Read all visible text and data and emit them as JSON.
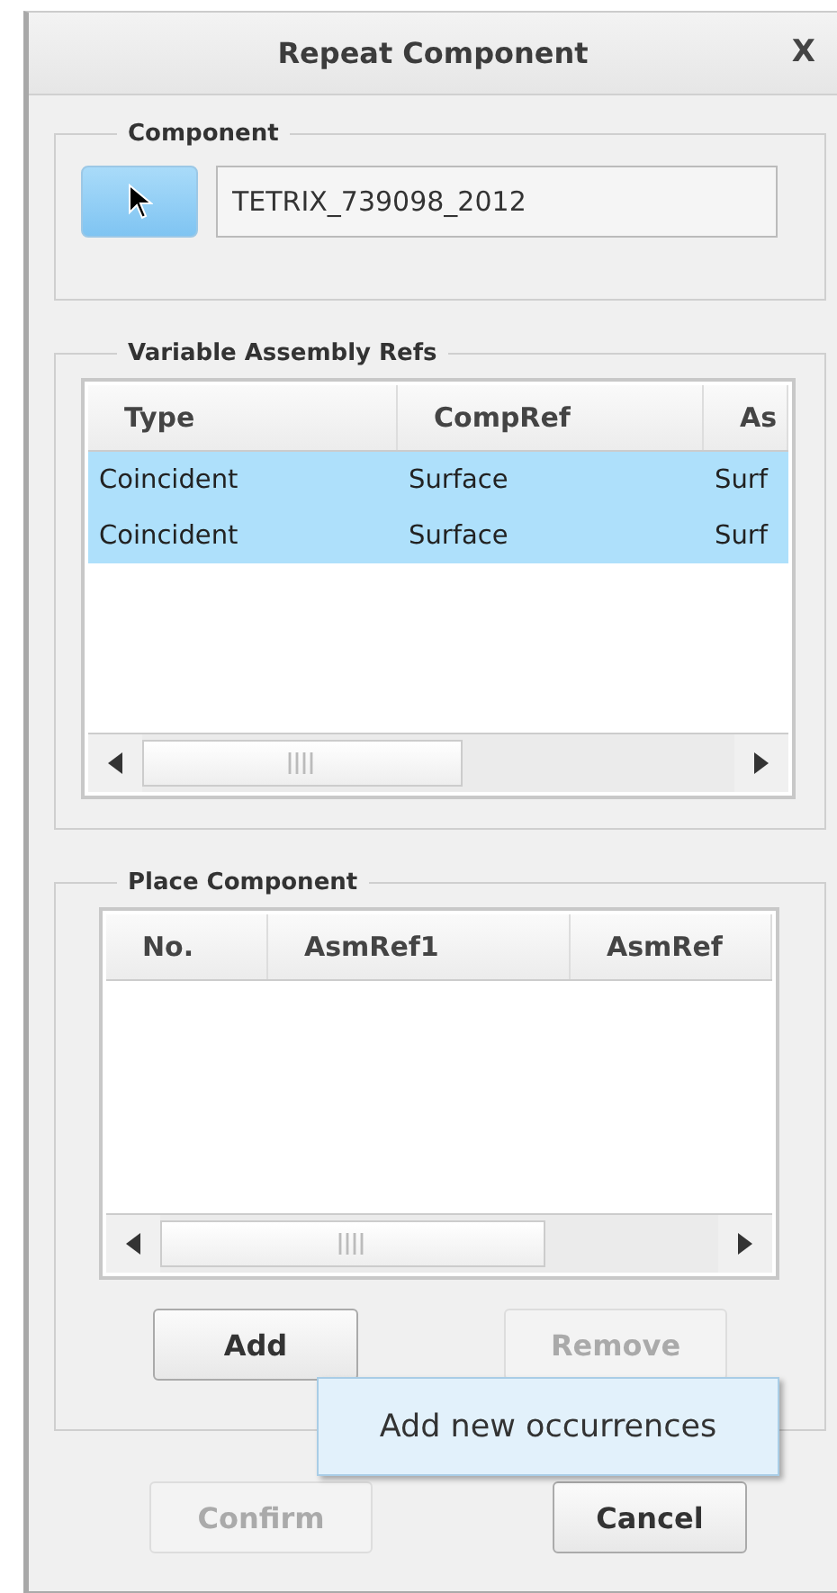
{
  "window": {
    "title": "Repeat Component",
    "close": "X"
  },
  "component": {
    "legend": "Component",
    "value": "TETRIX_739098_2012"
  },
  "variable_refs": {
    "legend": "Variable Assembly Refs",
    "columns": [
      "Type",
      "CompRef",
      "As"
    ],
    "rows": [
      {
        "cells": [
          "Coincident",
          "Surface",
          "Surf"
        ],
        "selected": true
      },
      {
        "cells": [
          "Coincident",
          "Surface",
          "Surf"
        ],
        "selected": true
      }
    ]
  },
  "place_component": {
    "legend": "Place Component",
    "columns": [
      "No.",
      "AsmRef1",
      "AsmRef"
    ],
    "buttons": [
      {
        "label": "Add",
        "disabled": false
      },
      {
        "label": "Remove",
        "disabled": true
      }
    ]
  },
  "tooltip": "Add new occurrences",
  "buttons": [
    {
      "label": "Confirm",
      "disabled": true
    },
    {
      "label": "Cancel",
      "disabled": false
    }
  ]
}
